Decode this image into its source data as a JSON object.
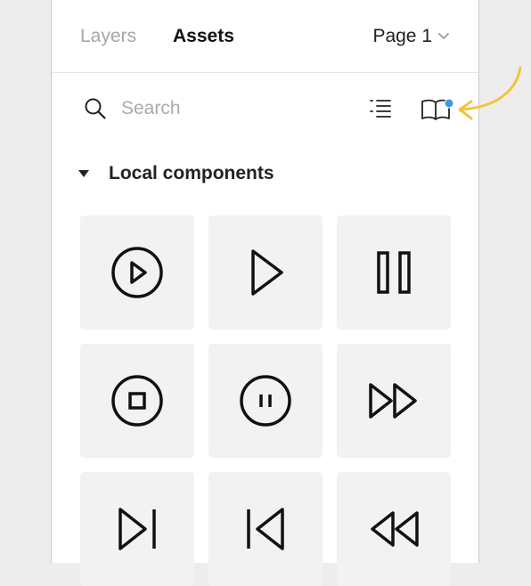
{
  "tabs": {
    "layers": "Layers",
    "assets": "Assets"
  },
  "page_selector": {
    "label": "Page 1"
  },
  "search": {
    "placeholder": "Search",
    "value": ""
  },
  "section": {
    "title": "Local components"
  },
  "components": [
    {
      "icon": "play-circle-icon"
    },
    {
      "icon": "play-icon"
    },
    {
      "icon": "pause-icon"
    },
    {
      "icon": "stop-circle-icon"
    },
    {
      "icon": "pause-circle-icon"
    },
    {
      "icon": "fast-forward-icon"
    },
    {
      "icon": "skip-forward-icon"
    },
    {
      "icon": "skip-back-icon"
    },
    {
      "icon": "rewind-icon"
    }
  ],
  "colors": {
    "notification_dot": "#3d9be0",
    "annotation_arrow": "#f2c33b",
    "tile_bg": "#f2f2f2"
  }
}
